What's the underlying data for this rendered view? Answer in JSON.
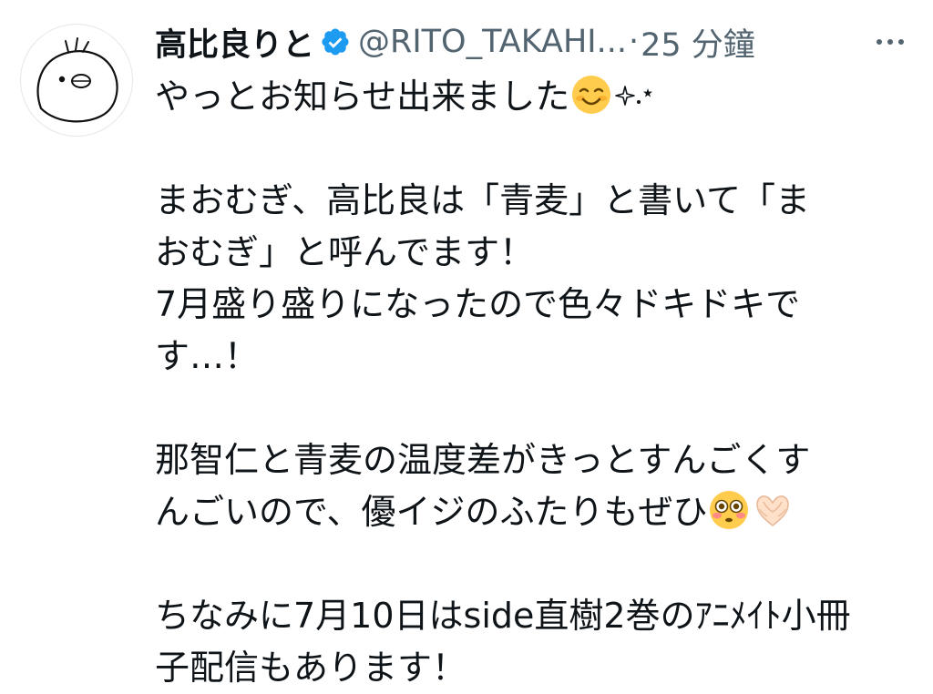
{
  "tweet": {
    "display_name": "高比良りと",
    "handle": "@RITO_TAKAHI...",
    "separator": "·",
    "timestamp": "25 分鐘",
    "verified": true,
    "avatar_icon": "cartoon-bird-face-icon",
    "more_icon": "more-options-icon",
    "lines": {
      "l1": "やっとお知らせ出来ました",
      "l1_after": ".",
      "l2": "まおむぎ、高比良は「青麦」と書いて「ま",
      "l3": "おむぎ」と呼んでます！",
      "l4": "7月盛り盛りになったので色々ドキドキで",
      "l5": "す…！",
      "l6": "那智仁と青麦の温度差がきっとすんごくす",
      "l7": "んごいので、優イジのふたりもぜひ",
      "l8": "ちなみに7月10日はside直樹2巻のｱﾆﾒｲﾄ小冊",
      "l9": "子配信もあります！"
    },
    "emojis": {
      "smile": "smiling-face-emoji",
      "sparkles": "sparkles-emoji",
      "flushed": "flushed-face-emoji",
      "heart_hands": "heart-hands-emoji"
    },
    "colors": {
      "text": "#0f1419",
      "secondary": "#536471",
      "verified": "#1d9bf0"
    }
  }
}
